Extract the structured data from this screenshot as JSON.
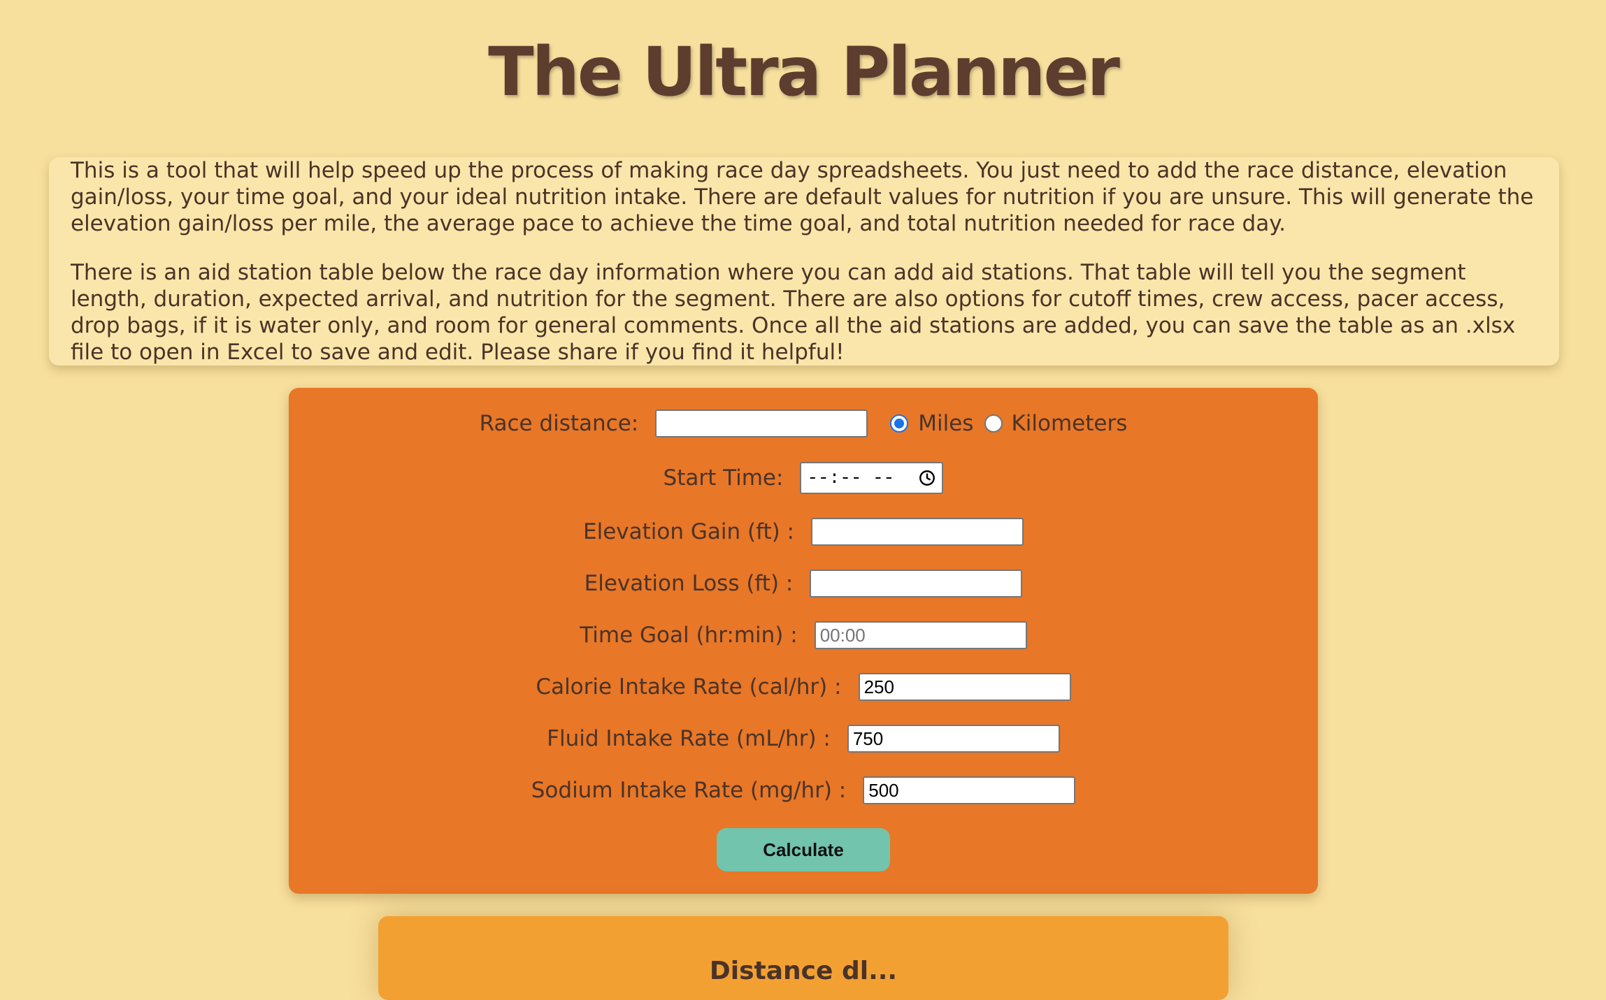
{
  "header": {
    "title": "The Ultra Planner"
  },
  "intro": {
    "paragraph_1": "This is a tool that will help speed up the process of making race day spreadsheets. You just need to add the race distance, elevation gain/loss, your time goal, and your ideal nutrition intake. There are default values for nutrition if you are unsure. This will generate the elevation gain/loss per mile, the average pace to achieve the time goal, and total nutrition needed for race day.",
    "paragraph_2": "There is an aid station table below the race day information where you can add aid stations. That table will tell you the segment length, duration, expected arrival, and nutrition for the segment. There are also options for cutoff times, crew access, pacer access, drop bags, if it is water only, and room for general comments. Once all the aid stations are added, you can save the table as an .xlsx file to open in Excel to save and edit. Please share if you find it helpful!"
  },
  "form": {
    "race_distance_label": "Race distance:",
    "race_distance_value": "",
    "unit_miles_label": "Miles",
    "unit_km_label": "Kilometers",
    "unit_selected": "miles",
    "start_time_label": "Start Time:",
    "start_time_placeholder": "--:-- --",
    "elevation_gain_label": "Elevation Gain (ft) :",
    "elevation_gain_value": "",
    "elevation_loss_label": "Elevation Loss (ft) :",
    "elevation_loss_value": "",
    "time_goal_label": "Time Goal (hr:min) :",
    "time_goal_placeholder": "00:00",
    "calorie_label": "Calorie Intake Rate (cal/hr) :",
    "calorie_value": "250",
    "fluid_label": "Fluid Intake Rate (mL/hr) :",
    "fluid_value": "750",
    "sodium_label": "Sodium Intake Rate (mg/hr) :",
    "sodium_value": "500",
    "calculate_label": "Calculate"
  },
  "results": {
    "heading": "Distance dl..."
  },
  "colors": {
    "background": "#f7df9d",
    "intro_card": "#fae6aa",
    "form_card": "#e87727",
    "results_card": "#f3a033",
    "button": "#72c4ac",
    "text": "#4a3328",
    "title": "#5c3d2e",
    "radio_accent": "#1a73e8"
  },
  "icons": {
    "time_picker": "clock-icon"
  }
}
